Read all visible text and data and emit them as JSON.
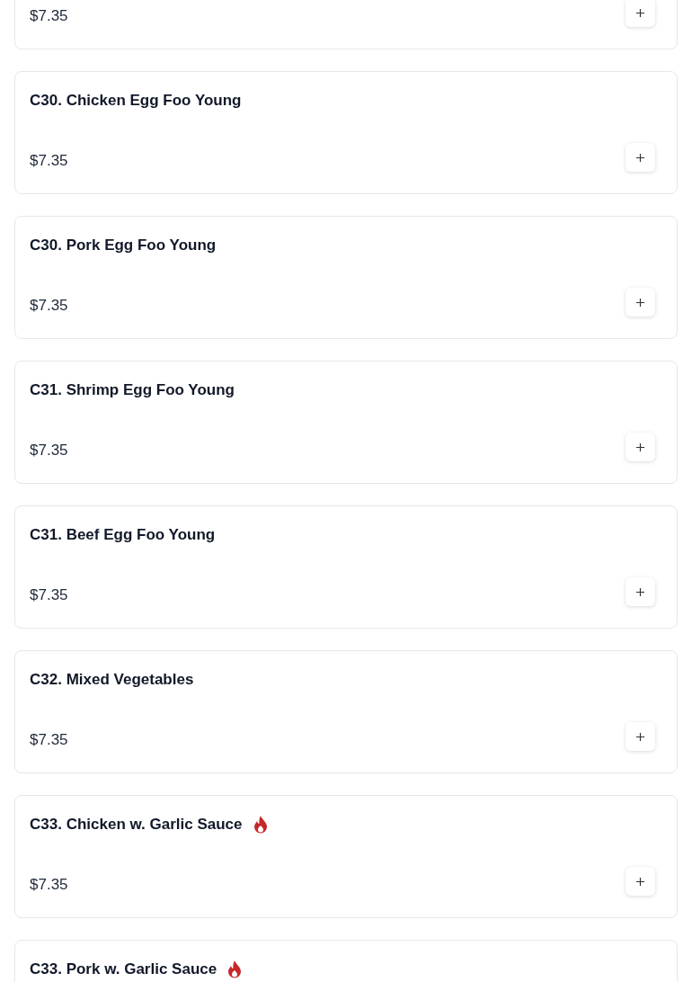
{
  "menu_items": [
    {
      "price": "$7.35"
    },
    {
      "name": "C30. Chicken Egg Foo Young",
      "price": "$7.35"
    },
    {
      "name": "C30. Pork Egg Foo Young",
      "price": "$7.35"
    },
    {
      "name": "C31. Shrimp Egg Foo Young",
      "price": "$7.35"
    },
    {
      "name": "C31. Beef Egg Foo Young",
      "price": "$7.35"
    },
    {
      "name": "C32. Mixed Vegetables",
      "price": "$7.35"
    },
    {
      "name": "C33. Chicken w. Garlic Sauce",
      "price": "$7.35",
      "spicy": true
    },
    {
      "name": "C33. Pork w. Garlic Sauce",
      "spicy": true
    }
  ]
}
